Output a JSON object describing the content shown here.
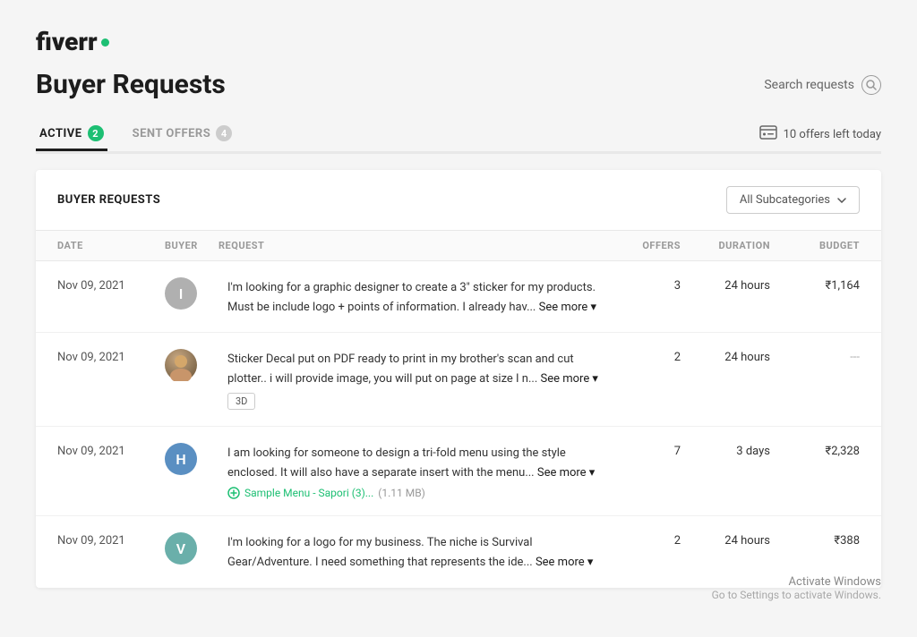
{
  "logo": {
    "text": "fiverr",
    "dot_color": "#1dbf73"
  },
  "header": {
    "title": "Buyer Requests",
    "search_placeholder": "Search requests"
  },
  "tabs": [
    {
      "label": "ACTIVE",
      "badge": "2",
      "active": true,
      "badge_color": "green"
    },
    {
      "label": "SENT OFFERS",
      "badge": "4",
      "active": false,
      "badge_color": "gray"
    }
  ],
  "offers_left": "10 offers left today",
  "card": {
    "title": "BUYER REQUESTS",
    "subcategory_label": "All Subcategories"
  },
  "table": {
    "columns": [
      "DATE",
      "BUYER",
      "REQUEST",
      "OFFERS",
      "DURATION",
      "BUDGET"
    ],
    "rows": [
      {
        "date": "Nov 09, 2021",
        "avatar_letter": "I",
        "avatar_color": "#b0b0b0",
        "request": "I'm looking for a graphic designer to create a 3\" sticker for my products. Must be include logo + points of information. I already hav...",
        "see_more": "See more",
        "tag": null,
        "attachment": null,
        "offers": "3",
        "duration": "24 hours",
        "budget": "₹1,164"
      },
      {
        "date": "Nov 09, 2021",
        "avatar_letter": null,
        "avatar_color": "#8b7355",
        "avatar_img": true,
        "request": "Sticker Decal put on PDF ready to print in my brother's scan and cut plotter.. i will provide image, you will put on page at size I n...",
        "see_more": "See more",
        "tag": "3D",
        "attachment": null,
        "offers": "2",
        "duration": "24 hours",
        "budget": "---"
      },
      {
        "date": "Nov 09, 2021",
        "avatar_letter": "H",
        "avatar_color": "#5a8fc2",
        "request": "I am looking for someone to design a tri-fold menu using the style enclosed. It will also have a separate insert with the menu...",
        "see_more": "See more",
        "tag": null,
        "attachment": "Sample Menu - Sapori (3)...",
        "attachment_size": "(1.11 MB)",
        "offers": "7",
        "duration": "3 days",
        "budget": "₹2,328"
      },
      {
        "date": "Nov 09, 2021",
        "avatar_letter": "V",
        "avatar_color": "#6aafaa",
        "request": "I'm looking for a logo for my business. The niche is Survival Gear/Adventure. I need something that represents the ide...",
        "see_more": "See more",
        "tag": null,
        "attachment": null,
        "offers": "2",
        "duration": "24 hours",
        "budget": "₹388"
      }
    ]
  },
  "watermark": {
    "title": "Activate Windows",
    "subtitle": "Go to Settings to activate Windows."
  }
}
